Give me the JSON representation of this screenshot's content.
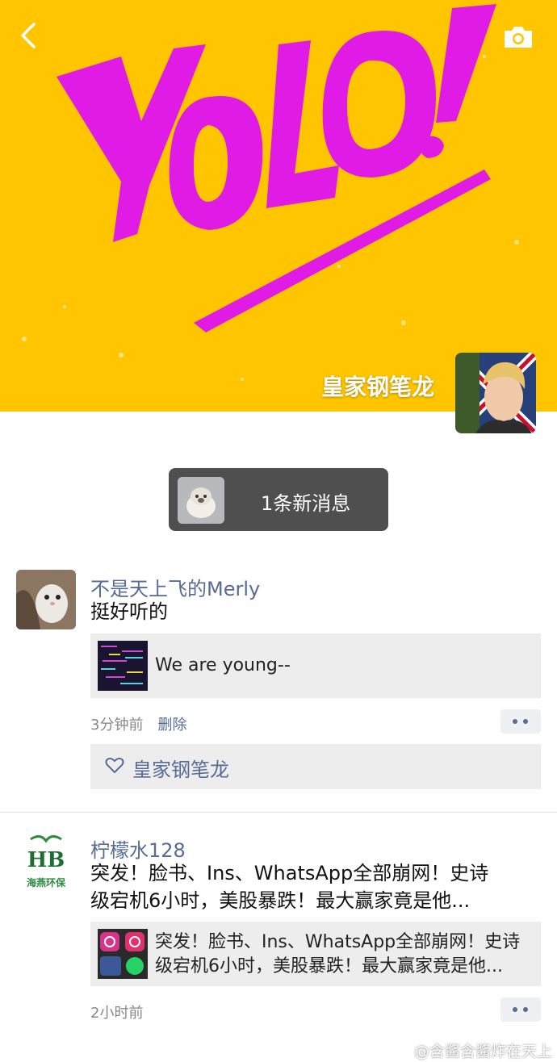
{
  "cover": {
    "artwork_text": "YOLO!",
    "owner_name": "皇家钢笔龙",
    "colors": {
      "background": "#FFC600",
      "lettering": "#E01BE5"
    }
  },
  "icons": {
    "back": "chevron-left-icon",
    "camera": "camera-icon",
    "like": "heart-icon",
    "more": "more-dots-icon"
  },
  "notification": {
    "text": "1条新消息"
  },
  "posts": [
    {
      "author": "不是天上飞的Merly",
      "text": "挺好听的",
      "link_title": "We are young--",
      "time": "3分钟前",
      "delete_label": "删除",
      "likes": [
        "皇家钢笔龙"
      ]
    },
    {
      "author": "柠檬水128",
      "text_line1": "突发！脸书、Ins、WhatsApp全部崩网！史诗",
      "text_line2": "级宕机6小时，美股暴跌！最大赢家竟是他...",
      "link_title_line1": "突发！脸书、Ins、WhatsApp全部崩网！史诗",
      "link_title_line2": "级宕机6小时，美股暴跌！最大赢家竟是他...",
      "time": "2小时前",
      "avatar_logo_text": "HB",
      "avatar_caption": "海燕环保"
    }
  ],
  "watermark": "@含酱含酱炸在天上"
}
